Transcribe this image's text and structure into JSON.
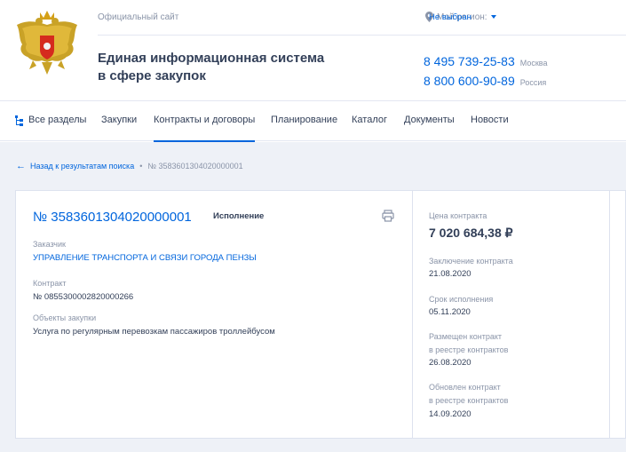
{
  "header": {
    "official_site": "Официальный сайт",
    "region_label": "Мой регион:",
    "region_value": "Не выбран",
    "system_title_line1": "Единая информационная система",
    "system_title_line2": "в сфере закупок",
    "phones": [
      {
        "number": "8 495 739-25-83",
        "city": "Москва"
      },
      {
        "number": "8 800 600-90-89",
        "city": "Россия"
      }
    ]
  },
  "nav": {
    "items": [
      "Все разделы",
      "Закупки",
      "Контракты и договоры",
      "Планирование",
      "Каталог",
      "Документы",
      "Новости"
    ],
    "active": "Контракты и договоры"
  },
  "breadcrumb": {
    "back": "Назад к результатам поиска",
    "current": "№ 3583601304020000001"
  },
  "contract": {
    "reg_number": "№ 3583601304020000001",
    "status": "Исполнение",
    "customer_label": "Заказчик",
    "customer_value": "УПРАВЛЕНИЕ ТРАНСПОРТА И СВЯЗИ ГОРОДА ПЕНЗЫ",
    "contract_label": "Контракт",
    "contract_value": "№ 0855300002820000266",
    "objects_label": "Объекты закупки",
    "objects_value": "Услуга по регулярным перевозкам пассажиров троллейбусом"
  },
  "side": {
    "price_label": "Цена контракта",
    "price_value": "7 020 684,38 ₽",
    "conclusion_label": "Заключение контракта",
    "conclusion_value": "21.08.2020",
    "deadline_label": "Срок исполнения",
    "deadline_value": "05.11.2020",
    "posted_label_1": "Размещен контракт",
    "posted_label_2": "в реестре контрактов",
    "posted_value": "26.08.2020",
    "updated_label_1": "Обновлен контракт",
    "updated_label_2": "в реестре контрактов",
    "updated_value": "14.09.2020"
  },
  "colors": {
    "accent": "#0065dd",
    "text": "#334059",
    "muted": "#8a94a8",
    "bg": "#eef1f7"
  }
}
